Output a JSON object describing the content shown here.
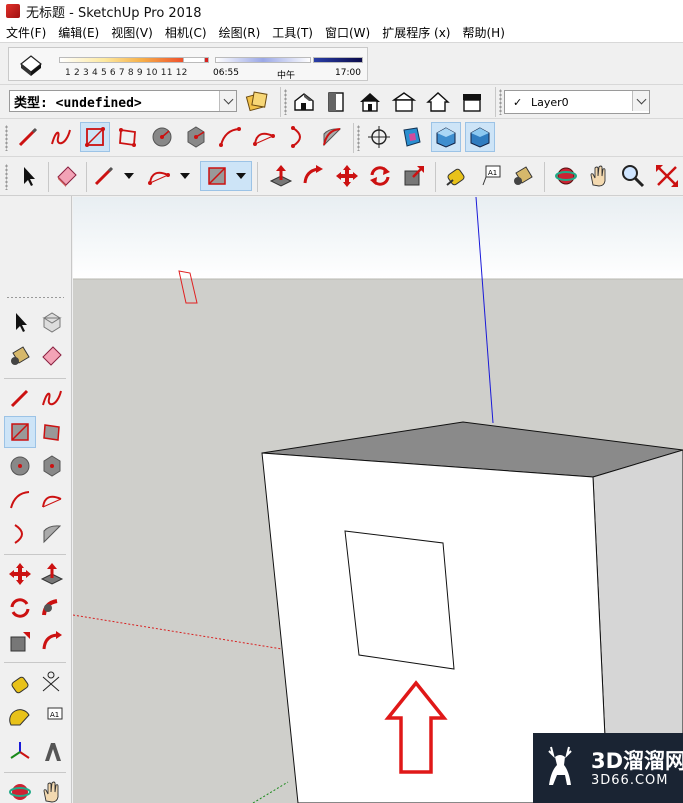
{
  "window": {
    "title": "无标题 - SketchUp Pro 2018"
  },
  "menu": [
    {
      "label": "文件(F)"
    },
    {
      "label": "编辑(E)"
    },
    {
      "label": "视图(V)"
    },
    {
      "label": "相机(C)"
    },
    {
      "label": "绘图(R)"
    },
    {
      "label": "工具(T)"
    },
    {
      "label": "窗口(W)"
    },
    {
      "label": "扩展程序 (x)"
    },
    {
      "label": "帮助(H)"
    }
  ],
  "shadows": {
    "months_label": "1 2 3 4 5 6 7 8 9 10 11 12",
    "time_start": "06:55",
    "time_mid": "中午",
    "time_end": "17:00"
  },
  "type_select": {
    "value": "类型: <undefined>"
  },
  "layers": {
    "current": "Layer0",
    "check": "✓"
  },
  "status_colors": {
    "active_tool_bg": "#cde4f7",
    "axis_blue": "#1a1ad8",
    "axis_red": "#d82020",
    "highlight_arrow": "#e01818"
  },
  "watermark": {
    "line1": "3D溜溜网",
    "line2": "3D66.COM"
  },
  "icons": {
    "active_tool": "rectangle-icon"
  }
}
